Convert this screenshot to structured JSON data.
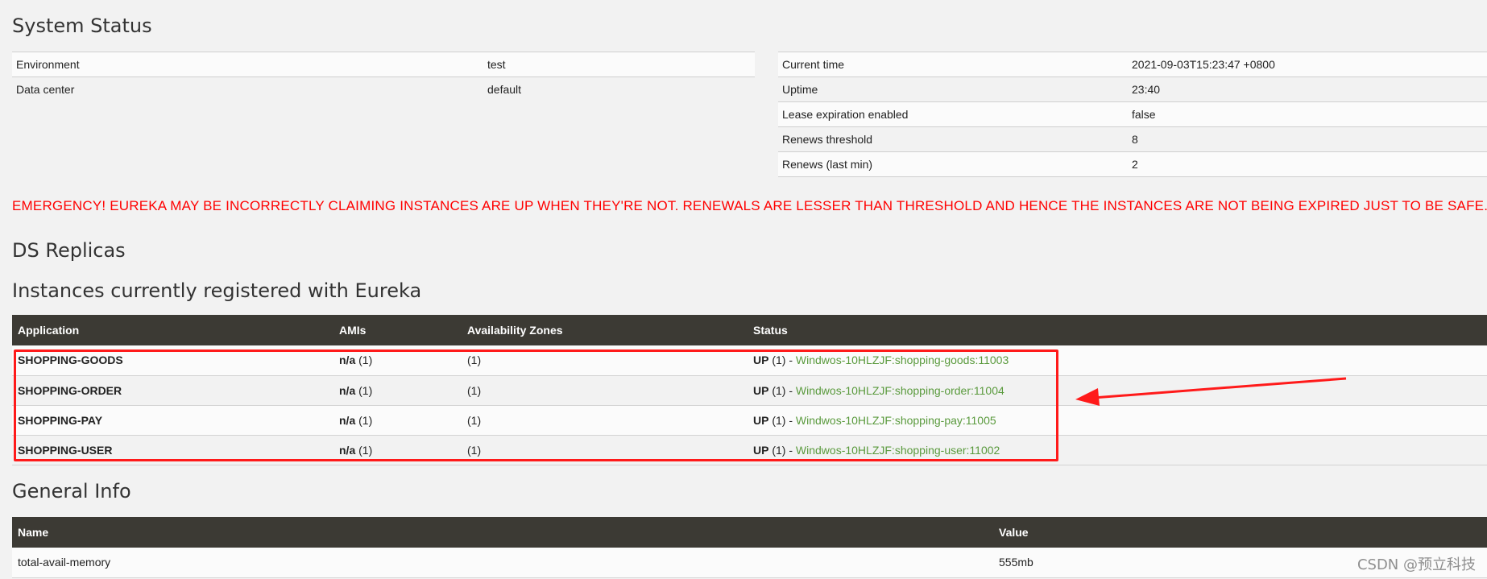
{
  "system_status": {
    "title": "System Status",
    "left": [
      {
        "label": "Environment",
        "value": "test"
      },
      {
        "label": "Data center",
        "value": "default"
      }
    ],
    "right": [
      {
        "label": "Current time",
        "value": "2021-09-03T15:23:47 +0800"
      },
      {
        "label": "Uptime",
        "value": "23:40"
      },
      {
        "label": "Lease expiration enabled",
        "value": "false"
      },
      {
        "label": "Renews threshold",
        "value": "8"
      },
      {
        "label": "Renews (last min)",
        "value": "2"
      }
    ]
  },
  "emergency": "EMERGENCY! EUREKA MAY BE INCORRECTLY CLAIMING INSTANCES ARE UP WHEN THEY'RE NOT. RENEWALS ARE LESSER THAN THRESHOLD AND HENCE THE INSTANCES ARE NOT BEING EXPIRED JUST TO BE SAFE.",
  "ds_replicas": {
    "title": "DS Replicas"
  },
  "instances": {
    "title": "Instances currently registered with Eureka",
    "headers": [
      "Application",
      "AMIs",
      "Availability Zones",
      "Status"
    ],
    "rows": [
      {
        "app": "SHOPPING-GOODS",
        "ami_label": "n/a",
        "ami_count": "(1)",
        "zones": "(1)",
        "status_label": "UP",
        "status_count": "(1) -",
        "instance": "Windwos-10HLZJF:shopping-goods:11003"
      },
      {
        "app": "SHOPPING-ORDER",
        "ami_label": "n/a",
        "ami_count": "(1)",
        "zones": "(1)",
        "status_label": "UP",
        "status_count": "(1) -",
        "instance": "Windwos-10HLZJF:shopping-order:11004"
      },
      {
        "app": "SHOPPING-PAY",
        "ami_label": "n/a",
        "ami_count": "(1)",
        "zones": "(1)",
        "status_label": "UP",
        "status_count": "(1) -",
        "instance": "Windwos-10HLZJF:shopping-pay:11005"
      },
      {
        "app": "SHOPPING-USER",
        "ami_label": "n/a",
        "ami_count": "(1)",
        "zones": "(1)",
        "status_label": "UP",
        "status_count": "(1) -",
        "instance": "Windwos-10HLZJF:shopping-user:11002"
      }
    ]
  },
  "general_info": {
    "title": "General Info",
    "headers": [
      "Name",
      "Value"
    ],
    "rows": [
      {
        "name": "total-avail-memory",
        "value": "555mb"
      }
    ]
  },
  "watermark": "CSDN @预立科技",
  "colors": {
    "emergency": "#ff0000",
    "header_bg": "#3c3a34",
    "link": "#5a9a3d",
    "annotation": "#ff1a1a"
  }
}
